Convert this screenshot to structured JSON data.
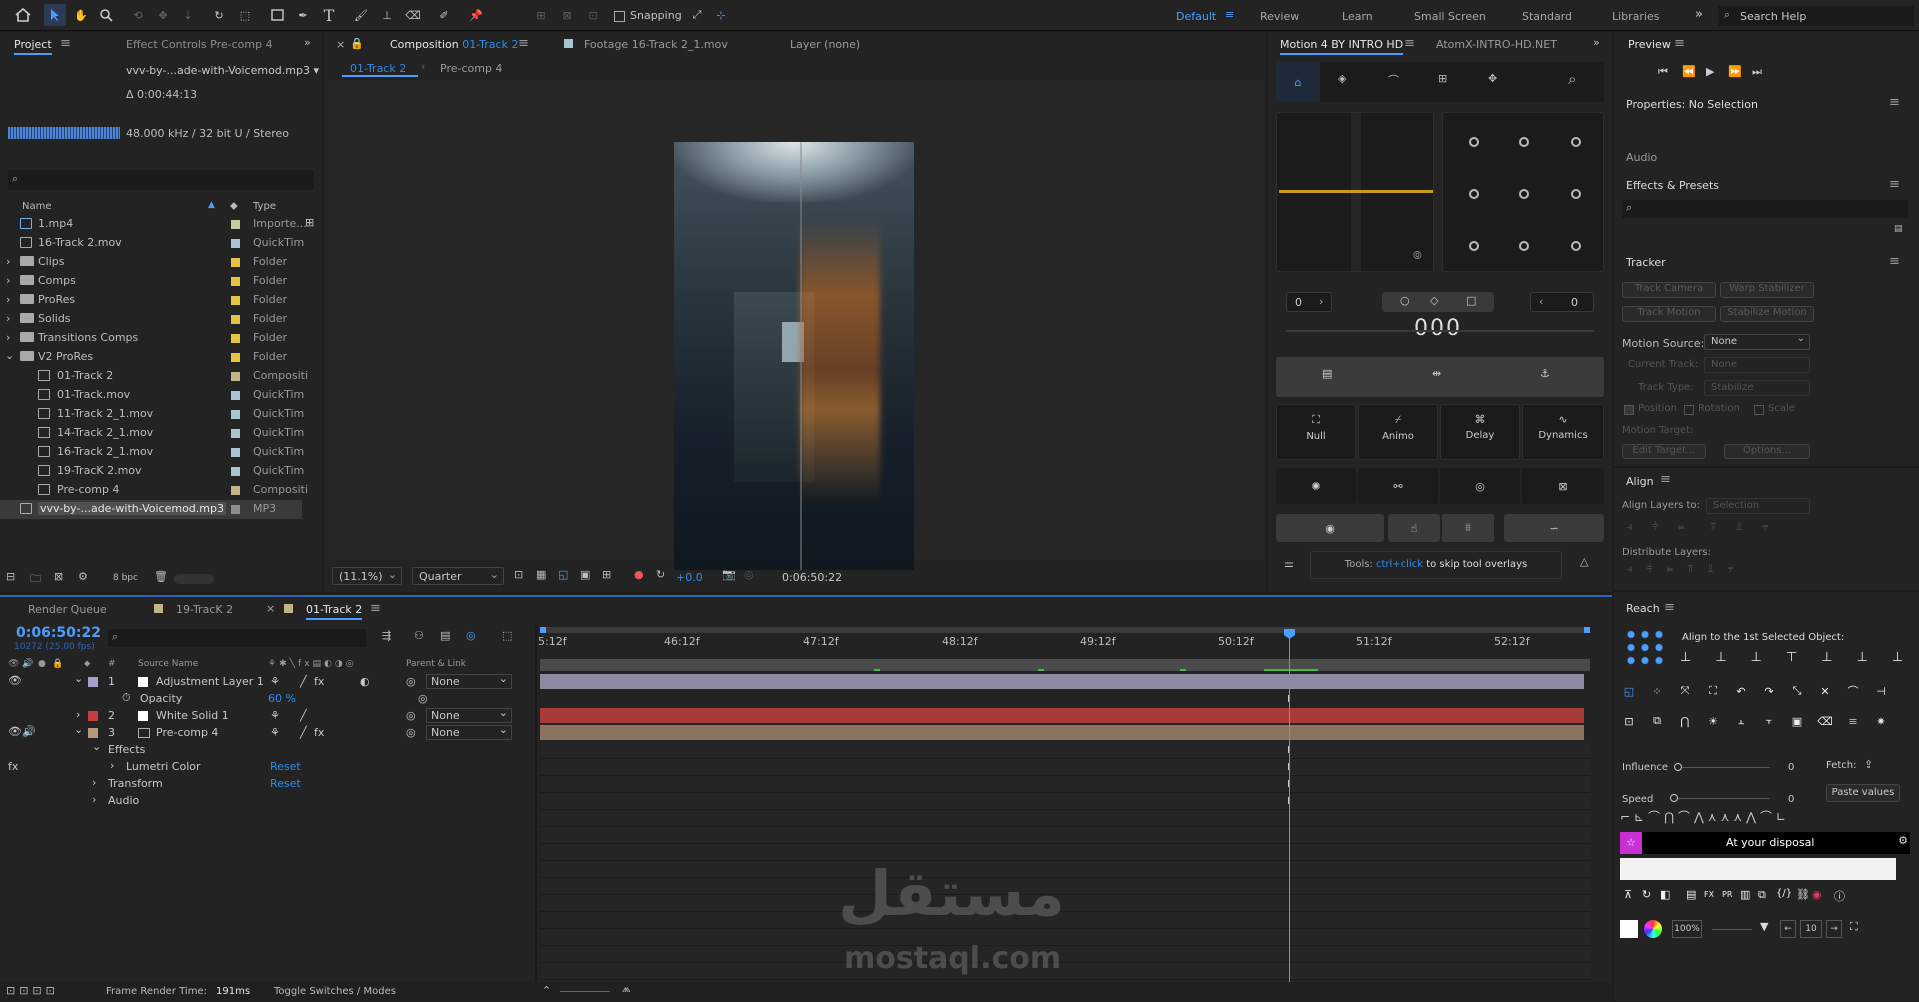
{
  "toolbar": {
    "snapping_label": "Snapping",
    "workspaces": [
      "Default",
      "Review",
      "Learn",
      "Small Screen",
      "Standard",
      "Libraries"
    ],
    "active_workspace": "Default",
    "search_placeholder": "Search Help"
  },
  "project": {
    "tab": "Project",
    "effect_controls_tab": "Effect Controls Pre-comp 4",
    "selected_file": "vvv-by-...ade-with-Voicemod.mp3 ▾",
    "duration": "Δ 0:00:44:13",
    "audio_info": "48.000 kHz / 32 bit U / Stereo",
    "col_name": "Name",
    "col_type": "Type",
    "items": [
      {
        "name": "1.mp4",
        "type": "Importe...",
        "color": "#c7c7a0",
        "kind": "file"
      },
      {
        "name": "16-Track 2.mov",
        "type": "QuickTim",
        "color": "#a7c6d1",
        "kind": "file"
      },
      {
        "name": "Clips",
        "type": "Folder",
        "color": "#e5c343",
        "kind": "folder"
      },
      {
        "name": "Comps",
        "type": "Folder",
        "color": "#e5c343",
        "kind": "folder"
      },
      {
        "name": "ProRes",
        "type": "Folder",
        "color": "#e5c343",
        "kind": "folder"
      },
      {
        "name": "Solids",
        "type": "Folder",
        "color": "#e5c343",
        "kind": "folder"
      },
      {
        "name": "Transitions Comps",
        "type": "Folder",
        "color": "#e5c343",
        "kind": "folder"
      },
      {
        "name": "V2 ProRes",
        "type": "Folder",
        "color": "#e5c343",
        "kind": "folder"
      },
      {
        "name": "01-Track 2",
        "type": "Compositi",
        "color": "#c2b488",
        "kind": "comp"
      },
      {
        "name": "01-Track.mov",
        "type": "QuickTim",
        "color": "#a7c6d1",
        "kind": "file"
      },
      {
        "name": "11-Track 2_1.mov",
        "type": "QuickTim",
        "color": "#a7c6d1",
        "kind": "file"
      },
      {
        "name": "14-Track 2_1.mov",
        "type": "QuickTim",
        "color": "#a7c6d1",
        "kind": "file"
      },
      {
        "name": "16-Track 2_1.mov",
        "type": "QuickTim",
        "color": "#a7c6d1",
        "kind": "file"
      },
      {
        "name": "19-TracK 2.mov",
        "type": "QuickTim",
        "color": "#a7c6d1",
        "kind": "file"
      },
      {
        "name": "Pre-comp 4",
        "type": "Compositi",
        "color": "#c2b488",
        "kind": "comp"
      },
      {
        "name": "vvv-by-...ade-with-Voicemod.mp3",
        "type": "MP3",
        "color": "#8d8d8d",
        "kind": "file"
      }
    ],
    "bpc": "8 bpc"
  },
  "composition": {
    "tab_label": "Composition",
    "tab_comp": "01-Track 2",
    "footage_tab": "Footage 16-Track 2_1.mov",
    "layer_tab": "Layer (none)",
    "sub_tabs": [
      "01-Track 2",
      "Pre-comp 4"
    ],
    "zoom": "(11.1%)",
    "quality": "Quarter",
    "exposure": "+0.0",
    "timecode": "0:06:50:22"
  },
  "motion": {
    "tab": "Motion 4 BY INTRO HD",
    "tab2": "AtomX-INTRO-HD.NET",
    "num_left": "0",
    "num_right": "0",
    "big_num": "000",
    "buttons": [
      "Null",
      "Animo",
      "Delay",
      "Dynamics"
    ],
    "tools_prefix": "Tools:",
    "tools_key": "ctrl+click",
    "tools_suffix": "to skip tool overlays"
  },
  "right": {
    "preview": "Preview",
    "properties": "Properties: No Selection",
    "audio": "Audio",
    "effects_presets": "Effects & Presets",
    "tracker": "Tracker",
    "track_camera": "Track Camera",
    "warp_stabilizer": "Warp Stabilizer",
    "track_motion": "Track Motion",
    "stabilize_motion": "Stabilize Motion",
    "motion_source_label": "Motion Source:",
    "motion_source_value": "None",
    "current_track_label": "Current Track:",
    "current_track_value": "None",
    "track_type_label": "Track Type:",
    "track_type_value": "Stabilize",
    "position": "Position",
    "rotation": "Rotation",
    "scale": "Scale",
    "motion_target": "Motion Target:",
    "edit_target": "Edit Target...",
    "options": "Options...",
    "align": "Align",
    "align_layers_to": "Align Layers to:",
    "align_layers_value": "Selection",
    "distribute_layers": "Distribute Layers:"
  },
  "reach": {
    "tab": "Reach",
    "align_text": "Align to the 1st Selected Object:",
    "influence_label": "Influence",
    "influence_value": "0",
    "fetch_label": "Fetch:",
    "speed_label": "Speed",
    "speed_value": "0",
    "paste_values": "Paste values",
    "disposal": "At your disposal",
    "percent": "100%",
    "num": "10"
  },
  "timeline": {
    "render_queue": "Render Queue",
    "tab1": "19-TracK 2",
    "tab2": "01-Track 2",
    "timecode": "0:06:50:22",
    "frames": "10272 (25.00 fps)",
    "col_source": "Source Name",
    "col_parent": "Parent & Link",
    "ruler": [
      "5:12f",
      "46:12f",
      "47:12f",
      "48:12f",
      "49:12f",
      "50:12f",
      "51:12f",
      "52:12f"
    ],
    "layers": [
      {
        "num": "1",
        "name": "Adjustment Layer 1",
        "color": "#a99fc9",
        "parent": "None"
      },
      {
        "num": "2",
        "name": "White Solid 1",
        "color": "#c63d3d",
        "parent": "None"
      },
      {
        "num": "3",
        "name": "Pre-comp 4",
        "color": "#b49a78",
        "parent": "None"
      }
    ],
    "opacity_label": "Opacity",
    "opacity_value": "60 %",
    "effects_label": "Effects",
    "lumetri": "Lumetri Color",
    "reset": "Reset",
    "transform": "Transform",
    "audio": "Audio",
    "frame_render_label": "Frame Render Time:",
    "frame_render_value": "191ms",
    "toggle": "Toggle Switches / Modes"
  },
  "watermark": {
    "arabic": "مستقل",
    "latin": "mostaql.com"
  }
}
